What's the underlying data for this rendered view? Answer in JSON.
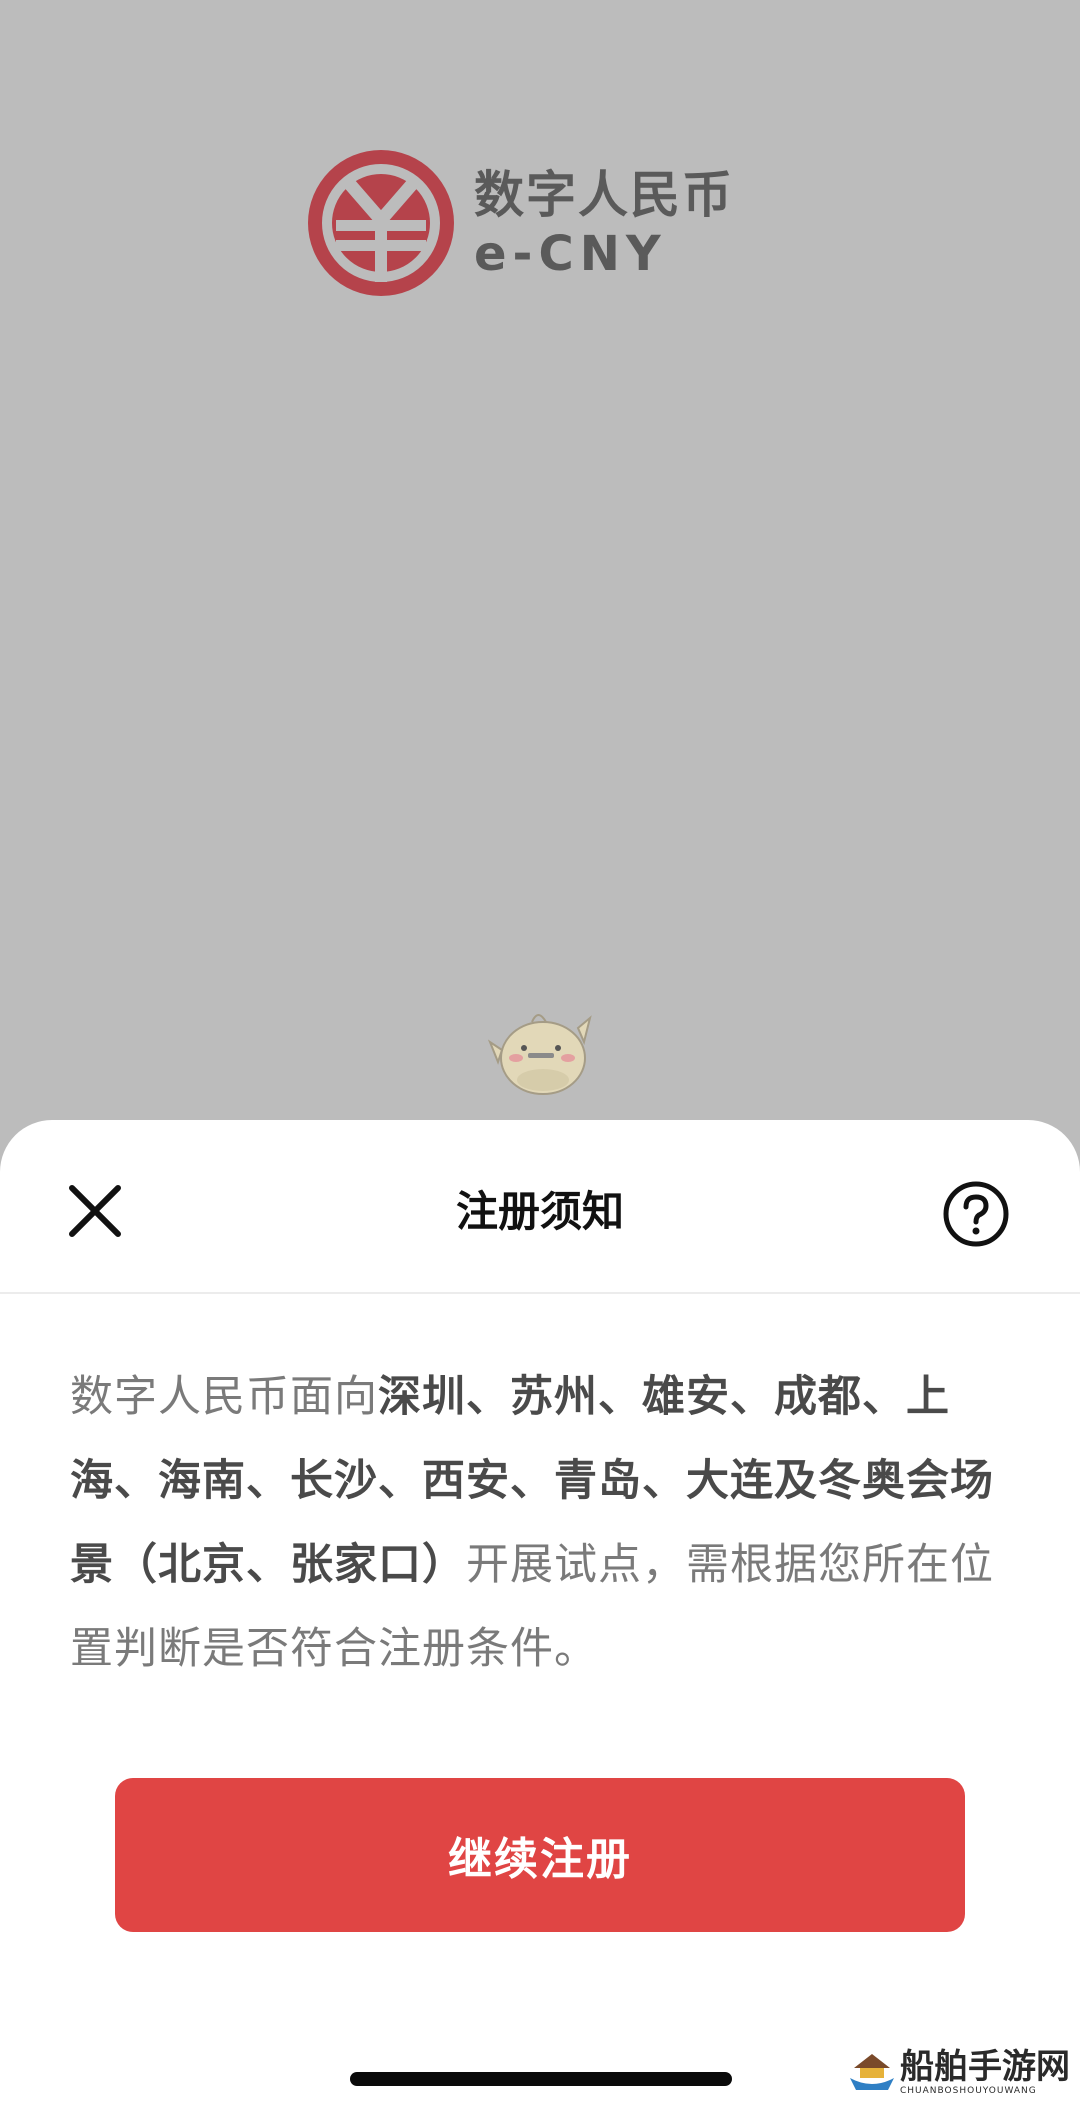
{
  "brand": {
    "name_cn": "数字人民币",
    "name_en": "e-CNY",
    "color": "#b5434b"
  },
  "sheet": {
    "title": "注册须知",
    "notice_parts": [
      {
        "text": "数字人民币面向",
        "strong": false
      },
      {
        "text": "深圳、苏州、雄安、成都、上海、海南、长沙、西安、青岛、大连及冬奥会场景（北京、张家口）",
        "strong": true
      },
      {
        "text": "开展试点，需根据您所在位置判断是否符合注册条件。",
        "strong": false
      }
    ],
    "continue_label": "继续注册",
    "accent_color": "#e04544"
  },
  "icons": {
    "close": "close-icon",
    "help": "help-icon",
    "mascot": "mascot-icon"
  },
  "watermark": {
    "cn": "船舶手游网",
    "en": "CHUANBOSHOUYOUWANG"
  }
}
